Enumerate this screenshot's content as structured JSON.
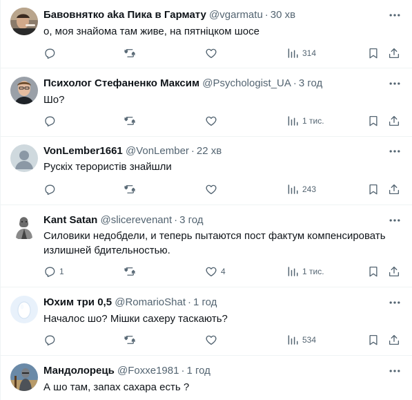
{
  "icons": {
    "more": "more-icon",
    "reply": "reply-icon",
    "retweet": "retweet-icon",
    "like": "like-icon",
    "views": "views-icon",
    "bookmark": "bookmark-icon",
    "share": "share-icon"
  },
  "colors": {
    "text": "#0f1419",
    "muted": "#536471",
    "divider": "#eff3f4"
  },
  "tweets": [
    {
      "name": "Бавовнятко aka Пика в Гармату",
      "handle": "@vgarmatu",
      "separator": "·",
      "time": "30 хв",
      "text": "о, моя знайома там живе, на пятніцком шосе",
      "replies": "",
      "retweets": "",
      "likes": "",
      "views": "314"
    },
    {
      "name": "Психолог Стефаненко Максим",
      "handle": "@Psychologist_UA",
      "separator": "·",
      "time": "3 год",
      "text": "Шо?",
      "replies": "",
      "retweets": "",
      "likes": "",
      "views": "1 тис."
    },
    {
      "name": "VonLember1661",
      "handle": "@VonLember",
      "separator": "·",
      "time": "22 хв",
      "text": "Рускіх терористів знайшли",
      "replies": "",
      "retweets": "",
      "likes": "",
      "views": "243"
    },
    {
      "name": "Kant Satan",
      "handle": "@slicerevenant",
      "separator": "·",
      "time": "3 год",
      "text": "Силовики недобдели, и теперь пытаются пост фактум компенсировать излишней бдительностью.",
      "replies": "1",
      "retweets": "",
      "likes": "4",
      "views": "1 тис."
    },
    {
      "name": "Юхим три 0,5",
      "handle": "@RomarioShat",
      "separator": "·",
      "time": "1 год",
      "text": "Началос шо? Мішки сахеру таскають?",
      "replies": "",
      "retweets": "",
      "likes": "",
      "views": "534"
    },
    {
      "name": "Мандолорець",
      "handle": "@Foxxe1981",
      "separator": "·",
      "time": "1 год",
      "text": "А шо там, запах сахара есть ?",
      "replies": "",
      "retweets": "",
      "likes": "",
      "views": ""
    }
  ]
}
